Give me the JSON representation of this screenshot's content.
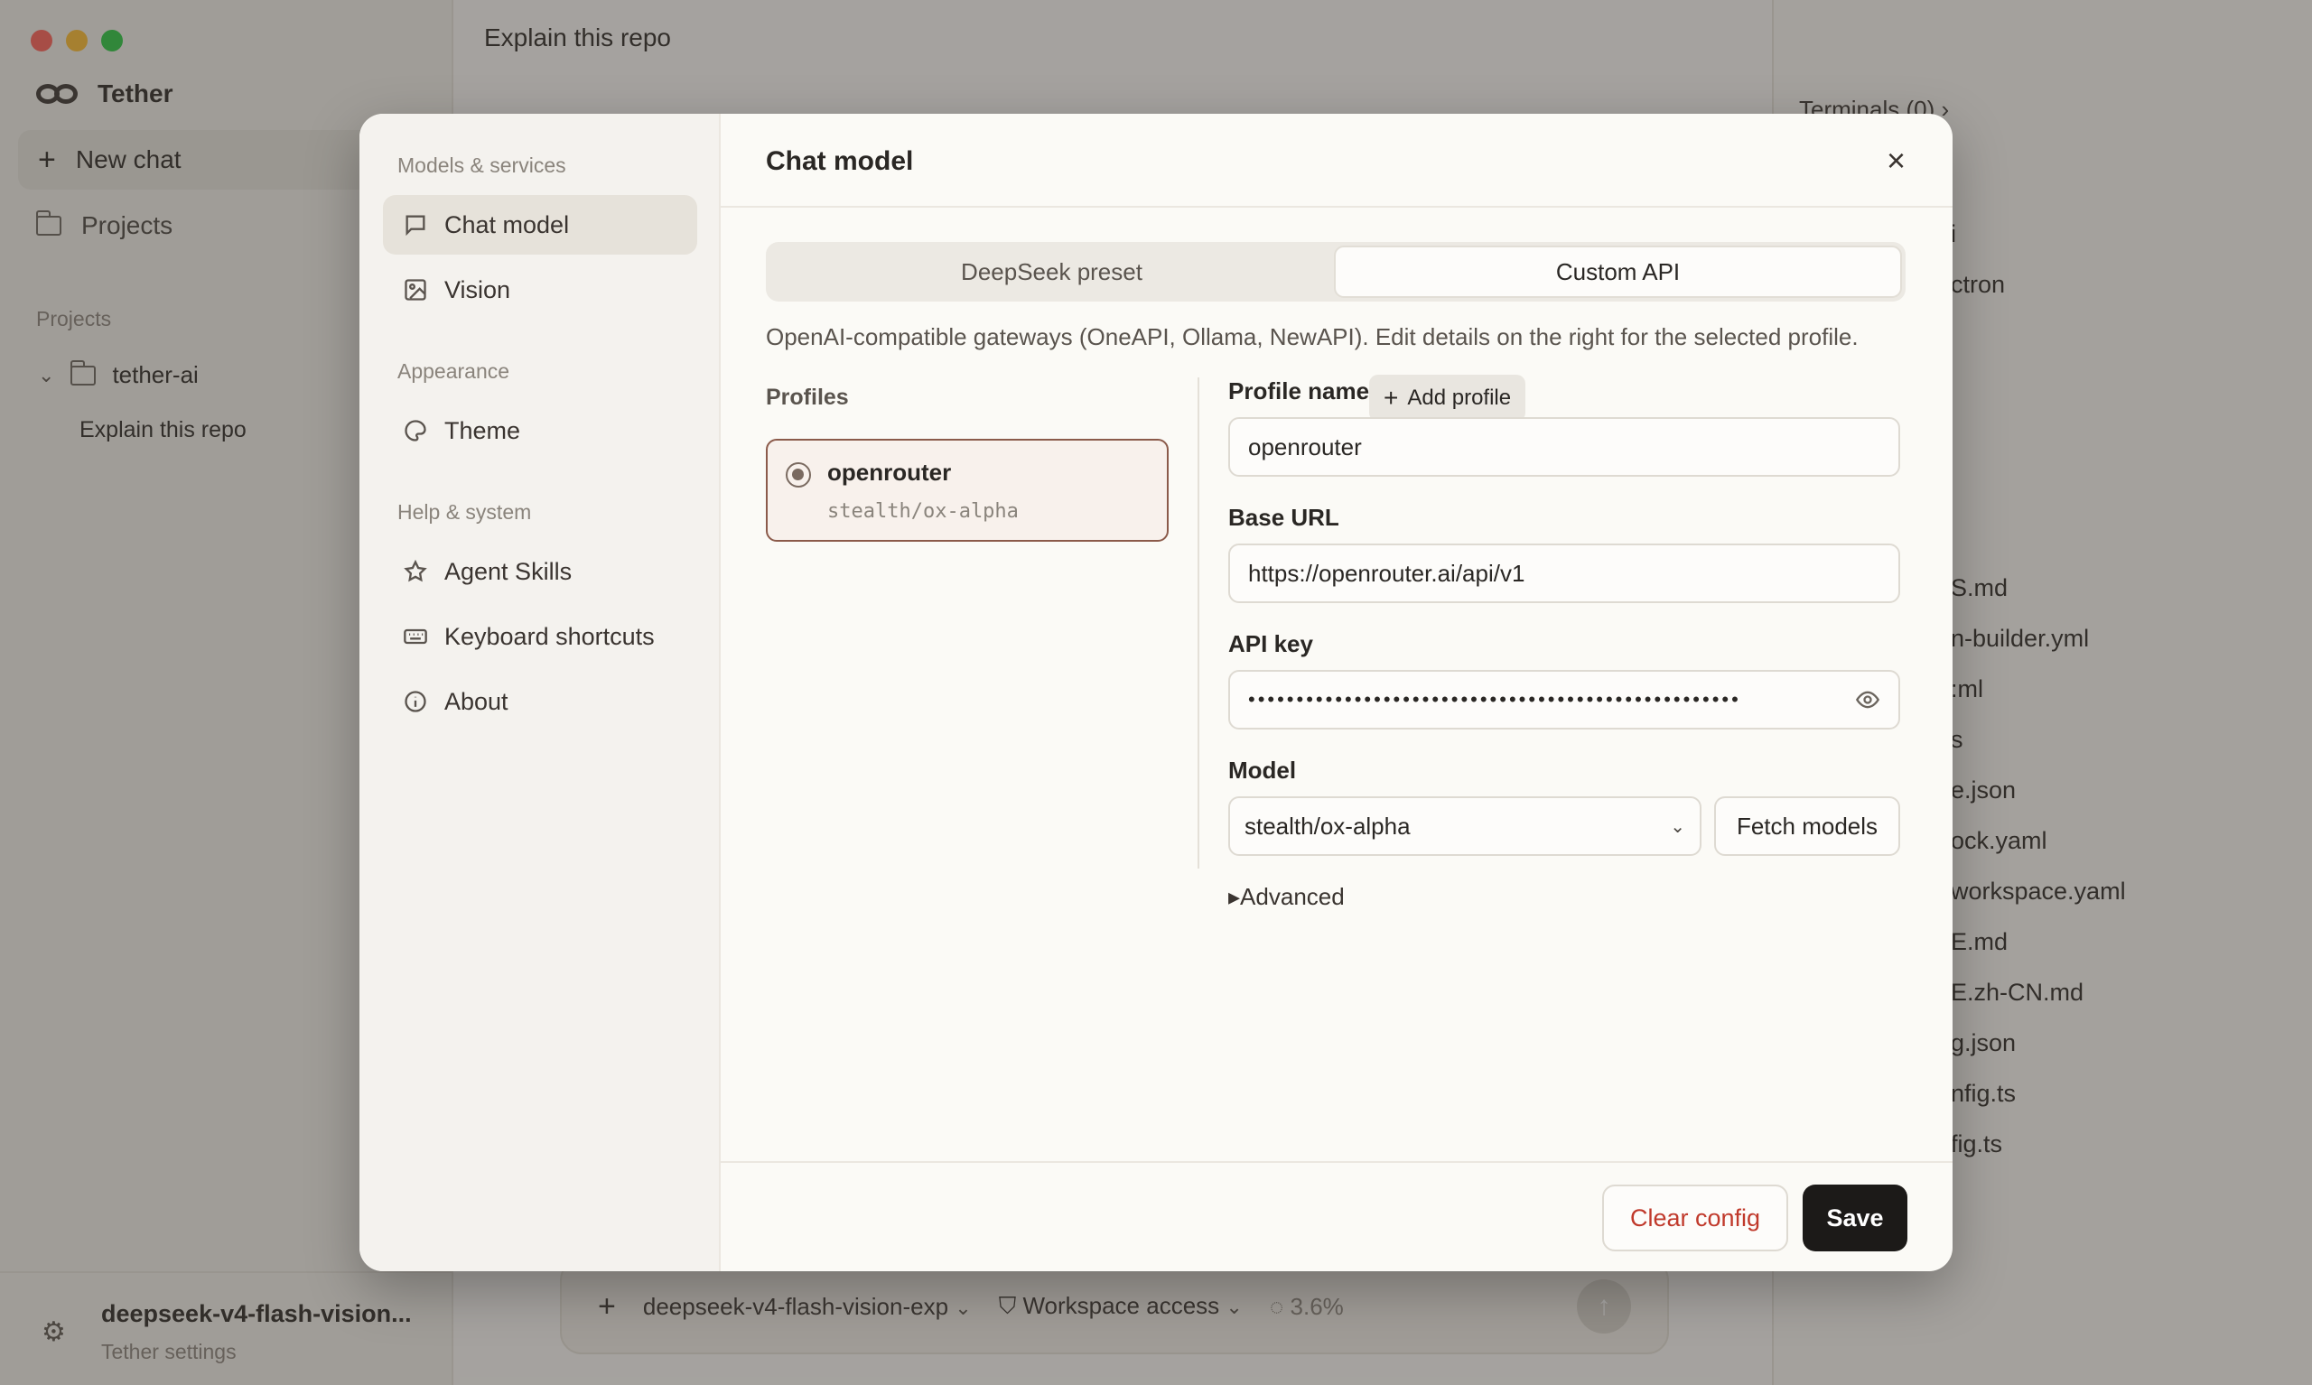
{
  "colors": {
    "close_dot": "#ff5f57",
    "minimize_dot": "#febc2e",
    "zoom_dot": "#28c840",
    "danger": "#c0392b",
    "accent_border": "#8b5a4a"
  },
  "app": {
    "brand": "Tether",
    "new_chat": "New chat",
    "projects_nav": "Projects",
    "projects_section": "Projects",
    "project_folder": "tether-ai",
    "project_chat": "Explain this repo",
    "footer_title": "deepseek-v4-flash-vision...",
    "footer_sub": "Tether settings",
    "chat_title": "Explain this repo",
    "composer": {
      "model": "deepseek-v4-flash-vision-exp",
      "access": "Workspace access",
      "usage": "3.6%"
    },
    "right_panel": {
      "header": "Terminals (0)",
      "files": [
        "i",
        "ctron",
        "S.md",
        "n-builder.yml",
        ":ml",
        "s",
        "e.json",
        "ock.yaml",
        "workspace.yaml",
        "E.md",
        "E.zh-CN.md",
        "g.json",
        "nfig.ts",
        "fig.ts"
      ]
    }
  },
  "modal": {
    "nav": {
      "section_models": "Models & services",
      "chat_model": "Chat model",
      "vision": "Vision",
      "section_appearance": "Appearance",
      "theme": "Theme",
      "section_help": "Help & system",
      "agent_skills": "Agent Skills",
      "keyboard_shortcuts": "Keyboard shortcuts",
      "about": "About"
    },
    "title": "Chat model",
    "close": "×",
    "tabs": {
      "preset": "DeepSeek preset",
      "custom": "Custom API"
    },
    "description": "OpenAI-compatible gateways (OneAPI, Ollama, NewAPI). Edit details on the right for the selected profile.",
    "profiles_label": "Profiles",
    "add_profile": "Add profile",
    "profile": {
      "name": "openrouter",
      "model": "stealth/ox-alpha"
    },
    "fields": {
      "profile_name_label": "Profile name",
      "profile_name_value": "openrouter",
      "base_url_label": "Base URL",
      "base_url_value": "https://openrouter.ai/api/v1",
      "api_key_label": "API key",
      "api_key_value": "•••••••••••••••••••••••••••••••••••••••••••••••••••",
      "model_label": "Model",
      "model_value": "stealth/ox-alpha",
      "fetch_models": "Fetch models",
      "advanced": "▸Advanced"
    },
    "footer": {
      "clear": "Clear config",
      "save": "Save"
    }
  }
}
